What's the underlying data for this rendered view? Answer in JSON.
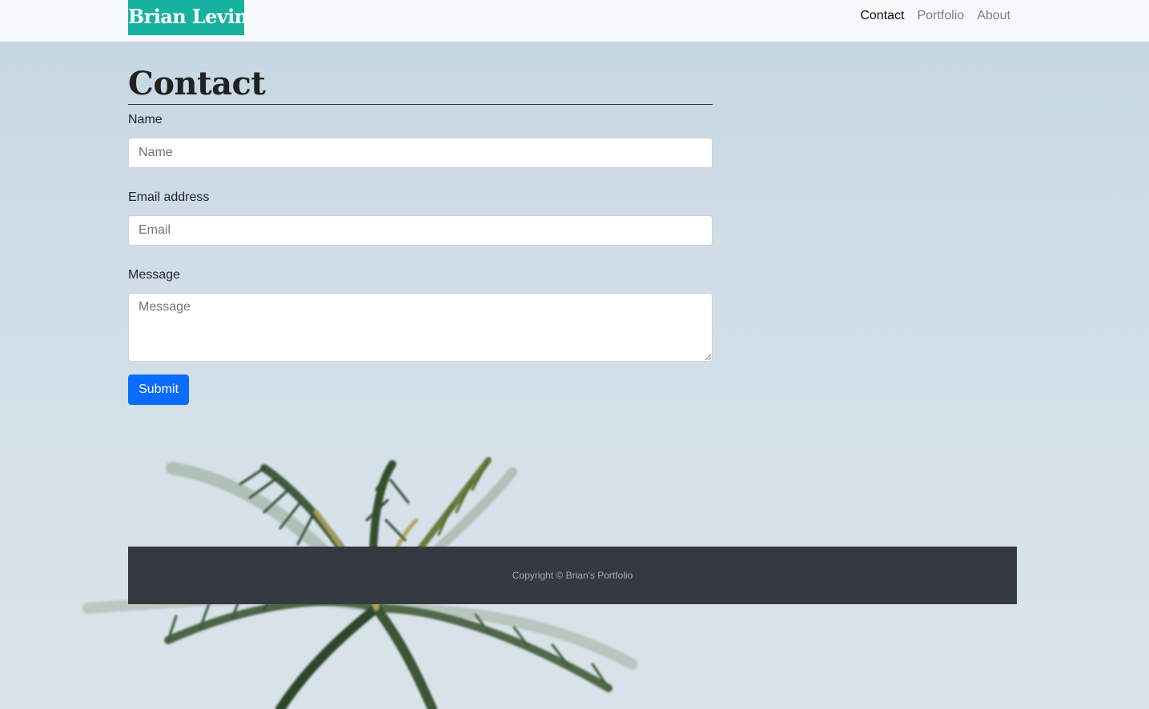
{
  "navbar": {
    "brand": "Brian Levin",
    "links": [
      {
        "label": "Contact",
        "active": true
      },
      {
        "label": "Portfolio",
        "active": false
      },
      {
        "label": "About",
        "active": false
      }
    ]
  },
  "contact": {
    "title": "Contact",
    "name_label": "Name",
    "name_placeholder": "Name",
    "email_label": "Email address",
    "email_placeholder": "Email",
    "message_label": "Message",
    "message_placeholder": "Message",
    "submit_label": "Submit"
  },
  "footer": {
    "copyright": "Copyright © Brian's Portfolio"
  },
  "colors": {
    "brand_bg": "#17b29d",
    "primary_button": "#0a6cff",
    "footer_bg": "#343a40",
    "navbar_bg": "#f8f9fa"
  }
}
